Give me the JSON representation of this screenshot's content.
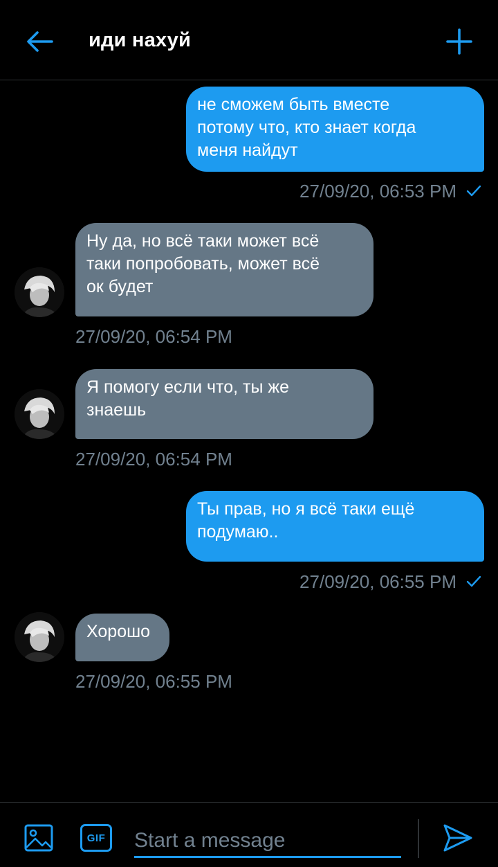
{
  "header": {
    "title": "иди нахуй",
    "back_icon": "arrow-left-icon",
    "new_icon": "plus-icon"
  },
  "messages": [
    {
      "direction": "out",
      "text": "не сможем быть вместе\nпотому что, кто знает когда\nменя найдут",
      "timestamp": "27/09/20, 06:53 PM",
      "read": true
    },
    {
      "direction": "in",
      "text": "Ну да, но всё таки может всё\nтаки попробовать, может всё\nок будет",
      "timestamp": "27/09/20, 06:54 PM"
    },
    {
      "direction": "in",
      "text": "Я помогу если что, ты же\nзнаешь",
      "timestamp": "27/09/20, 06:54 PM"
    },
    {
      "direction": "out",
      "text": "Ты прав, но я всё таки ещё\nподумаю..",
      "timestamp": "27/09/20, 06:55 PM",
      "read": true
    },
    {
      "direction": "in",
      "text": "Хорошо",
      "timestamp": "27/09/20, 06:55 PM"
    }
  ],
  "composer": {
    "placeholder": "Start a message",
    "gif_label": "GIF",
    "media_icon": "image-icon",
    "send_icon": "send-icon"
  },
  "colors": {
    "accent": "#1d9bf0",
    "incoming_bubble": "#657786",
    "timestamp": "#71818f",
    "background": "#000000"
  }
}
